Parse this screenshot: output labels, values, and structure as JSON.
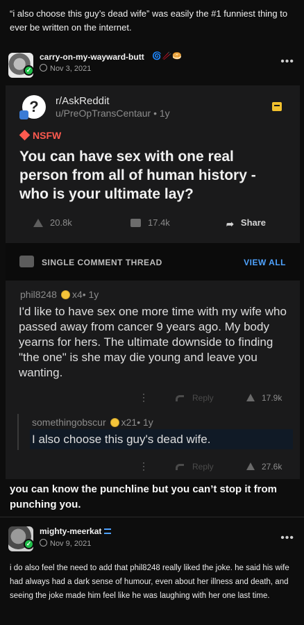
{
  "top_quote": "“i also choose this guy’s dead wife” was easily the #1 funniest thing to ever be written on the internet.",
  "post1": {
    "username": "carry-on-my-wayward-butt",
    "emoji": "🌀🥢🥯",
    "date": "Nov 3, 2021",
    "more": "•••"
  },
  "reddit": {
    "subreddit": "r/AskReddit",
    "user_age": "u/PreOpTransCentaur • 1y",
    "nsfw": "NSFW",
    "title": "You can have sex with one real person from all of human history - who is your ultimate lay?",
    "upvotes": "20.8k",
    "comments": "17.4k",
    "share": "Share",
    "thread_label": "SINGLE COMMENT THREAD",
    "view_all": "VIEW ALL"
  },
  "comment1": {
    "meta_user": "phil8248",
    "meta_award": "x4• 1y",
    "body": "I'd like to have sex one more time with my wife who passed away from cancer 9 years ago. My body yearns for hers. The ultimate downside to finding \"the one\" is she may die young and leave you wanting.",
    "reply": "Reply",
    "score": "17.9k"
  },
  "comment2": {
    "meta_user": "somethingobscur",
    "meta_award": "x21• 1y",
    "body": "I also choose this guy's dead wife.",
    "reply": "Reply",
    "score": "27.6k"
  },
  "punchline": "you can know the punchline but you can’t stop it from punching you.",
  "post2": {
    "username": "mighty-meerkat",
    "date": "Nov 9, 2021",
    "more": "•••",
    "body": "i do also feel the need to add that phil8248 really liked the joke. he said his wife had always had a dark sense of humour, even about her illness and death, and seeing the joke made him feel like he was laughing with her one last time."
  },
  "colors": {
    "nsfw": "#ff5a4f",
    "link": "#4fa3ff",
    "save": "#f2c12e",
    "badge": "#1fbf4a"
  }
}
